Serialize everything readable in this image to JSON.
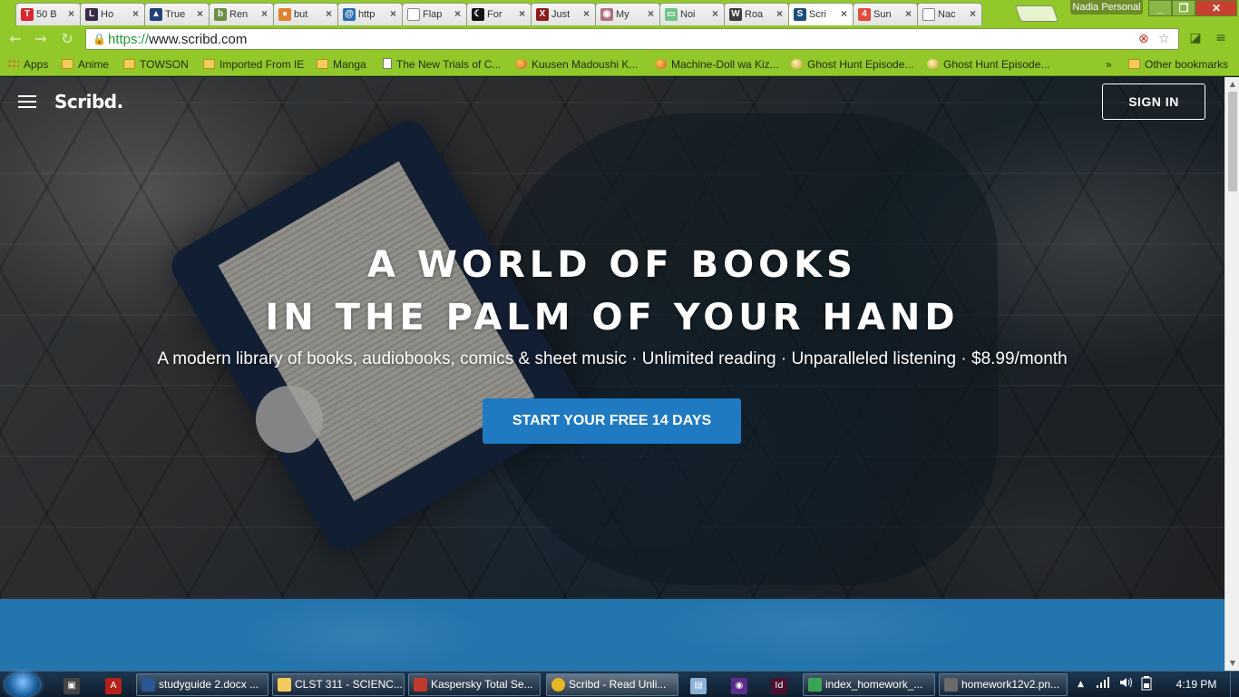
{
  "browser": {
    "tabs": [
      {
        "label": "50 B",
        "icon": "letter-t-icon",
        "color": "#d8262f",
        "glyph": "T"
      },
      {
        "label": "Ho",
        "icon": "letter-l-icon",
        "color": "#3a2b4a",
        "glyph": "L"
      },
      {
        "label": "True",
        "icon": "mountain-icon",
        "color": "#23427a",
        "glyph": "▲"
      },
      {
        "label": "Ren",
        "icon": "letter-b-icon",
        "color": "#6a8f45",
        "glyph": "b"
      },
      {
        "label": "but",
        "icon": "fox-icon",
        "color": "#e2812c",
        "glyph": "●"
      },
      {
        "label": "http",
        "icon": "swirl-icon",
        "color": "#2c6fb0",
        "glyph": "@"
      },
      {
        "label": "Flap",
        "icon": "page-icon",
        "color": "#e0e0e0",
        "glyph": ""
      },
      {
        "label": "For",
        "icon": "moon-icon",
        "color": "#111111",
        "glyph": "☾"
      },
      {
        "label": "Just",
        "icon": "letter-x-icon",
        "color": "#8f1a1a",
        "glyph": "X"
      },
      {
        "label": "My",
        "icon": "eye-icon",
        "color": "#b07080",
        "glyph": "◉"
      },
      {
        "label": "Noi",
        "icon": "green-window-icon",
        "color": "#6fc48a",
        "glyph": "▭"
      },
      {
        "label": "Roa",
        "icon": "wordpress-icon",
        "color": "#3d3d3d",
        "glyph": "W"
      },
      {
        "label": "Scri",
        "icon": "scribd-icon",
        "color": "#1b4f7a",
        "glyph": "S"
      },
      {
        "label": "Sun",
        "icon": "notification-icon",
        "color": "#e04b3c",
        "glyph": "4"
      },
      {
        "label": "Nac",
        "icon": "page-icon",
        "color": "#e0e0e0",
        "glyph": ""
      }
    ],
    "close_glyph": "×",
    "profile_label": "Nadia Personal",
    "window_buttons": {
      "minimize": "_",
      "maximize": "❐",
      "close": "✕"
    },
    "url_scheme": "https://",
    "url_host": "www.scribd.com",
    "nav": {
      "back": "←",
      "forward": "→",
      "reload": "↻"
    },
    "bookmarks": [
      {
        "label": "Apps",
        "icon": "apps-grid-icon",
        "type": "grid"
      },
      {
        "label": "Anime",
        "icon": "folder-icon",
        "type": "folder"
      },
      {
        "label": "TOWSON",
        "icon": "folder-icon",
        "type": "folder"
      },
      {
        "label": "Imported From IE",
        "icon": "folder-icon",
        "type": "folder"
      },
      {
        "label": "Manga",
        "icon": "folder-icon",
        "type": "folder"
      },
      {
        "label": "The New Trials of C...",
        "icon": "page-icon",
        "type": "page"
      },
      {
        "label": "Kuusen Madoushi K...",
        "icon": "kissanime-icon",
        "type": "ball"
      },
      {
        "label": "Machine-Doll wa Kiz...",
        "icon": "kissanime-icon",
        "type": "ball"
      },
      {
        "label": "Ghost Hunt Episode...",
        "icon": "anime-site-icon",
        "type": "hunt"
      },
      {
        "label": "Ghost Hunt Episode...",
        "icon": "anime-site-icon",
        "type": "hunt"
      }
    ],
    "bookmarks_overflow": "»",
    "other_bookmarks": "Other bookmarks"
  },
  "page": {
    "logo": "Scribd.",
    "sign_in": "SIGN IN",
    "headline_line1": "A WORLD OF BOOKS",
    "headline_line2": "IN THE PALM OF YOUR HAND",
    "subheadline": "A modern library of books, audiobooks, comics & sheet music · Unlimited reading · Unparalleled listening · $8.99/month",
    "cta": "START YOUR FREE 14 DAYS",
    "cta_color": "#1f7ac2",
    "band_color": "#2474ad"
  },
  "taskbar": {
    "tasks": [
      {
        "label": "studyguide 2.docx ...",
        "icon": "word-icon",
        "color": "#2b5797"
      },
      {
        "label": "CLST 311 - SCIENC...",
        "icon": "folder-icon",
        "color": "#f2cb5c"
      },
      {
        "label": "Kaspersky Total Se...",
        "icon": "kaspersky-icon",
        "color": "#c0392b"
      },
      {
        "label": "Scribd - Read Unli...",
        "icon": "chrome-icon",
        "color": "#e8b622"
      },
      {
        "label": "index_homework_...",
        "icon": "brackets-icon",
        "color": "#3aa655"
      },
      {
        "label": "homework12v2.pn...",
        "icon": "photo-viewer-icon",
        "color": "#6a6a6a"
      }
    ],
    "pins": [
      {
        "name": "media-player-icon",
        "glyph": "▣",
        "color": "#444"
      },
      {
        "name": "pdf-icon",
        "glyph": "A",
        "color": "#b3211c"
      },
      {
        "name": "calculator-icon",
        "glyph": "▤",
        "color": "#8db1d8"
      },
      {
        "name": "onenote-icon",
        "glyph": "◉",
        "color": "#5b2d8a"
      },
      {
        "name": "indesign-icon",
        "glyph": "Id",
        "color": "#4a1030"
      }
    ],
    "tray": {
      "arrow": "▲",
      "signal": "📶",
      "volume": "🔊",
      "battery": "▯"
    },
    "time": "4:19 PM"
  },
  "scrollbar": {
    "up": "▲",
    "down": "▼"
  }
}
